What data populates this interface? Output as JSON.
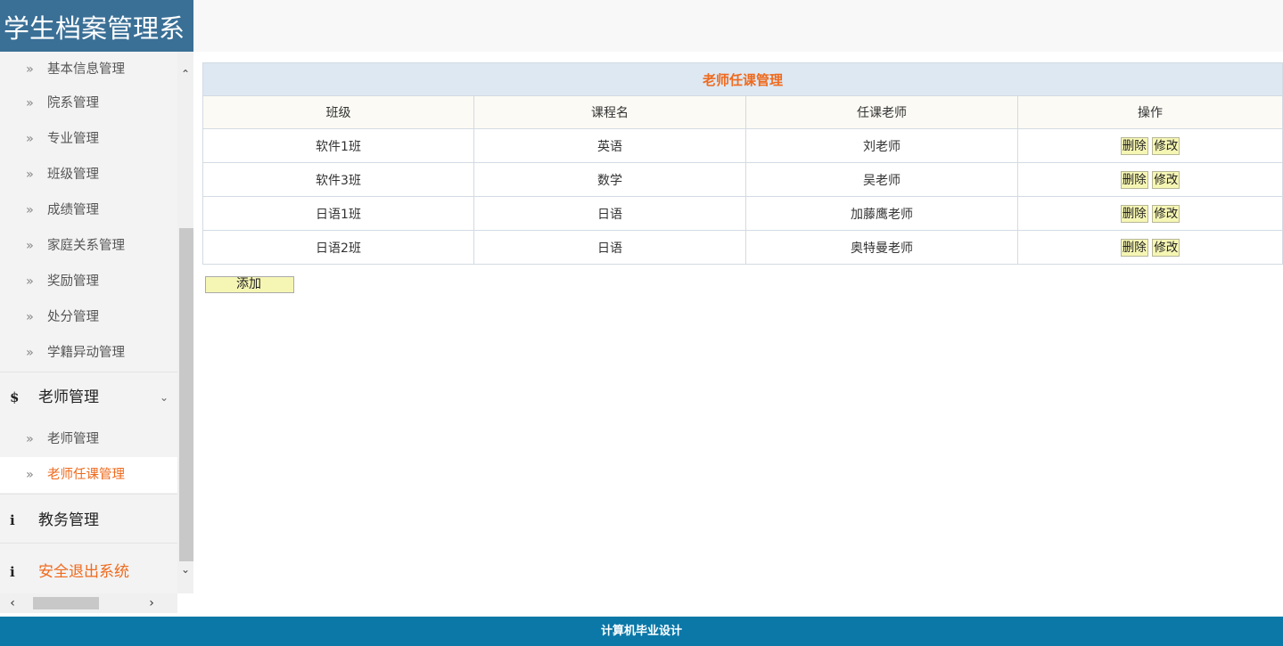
{
  "app": {
    "title": "学生档案管理系"
  },
  "sidebar": {
    "submenu_a": [
      {
        "label": "基本信息管理"
      },
      {
        "label": "院系管理"
      },
      {
        "label": "专业管理"
      },
      {
        "label": "班级管理"
      },
      {
        "label": "成绩管理"
      },
      {
        "label": "家庭关系管理"
      },
      {
        "label": "奖励管理"
      },
      {
        "label": "处分管理"
      },
      {
        "label": "学籍异动管理"
      }
    ],
    "teacher_group": {
      "icon_char": "$",
      "label": "老师管理",
      "items": [
        {
          "label": "老师管理"
        },
        {
          "label": "老师任课管理",
          "active": true
        }
      ]
    },
    "academic_group": {
      "icon_char": "i",
      "label": "教务管理"
    },
    "logout_group": {
      "icon_char": "i",
      "label": "安全退出系统"
    },
    "arrow_glyph": "»"
  },
  "main": {
    "table_title": "老师任课管理",
    "columns": [
      "班级",
      "课程名",
      "任课老师",
      "操作"
    ],
    "rows": [
      {
        "class": "软件1班",
        "course": "英语",
        "teacher": "刘老师"
      },
      {
        "class": "软件3班",
        "course": "数学",
        "teacher": "吴老师"
      },
      {
        "class": "日语1班",
        "course": "日语",
        "teacher": "加藤鹰老师"
      },
      {
        "class": "日语2班",
        "course": "日语",
        "teacher": "奥特曼老师"
      }
    ],
    "delete_label": "删除",
    "edit_label": "修改",
    "add_label": "添加"
  },
  "footer": {
    "text": "计算机毕业设计"
  },
  "colors": {
    "logo_bg": "#3a6f96",
    "accent": "#ef6a1d",
    "footer_bg": "#0b78a8",
    "button_bg": "#f6f6b4"
  }
}
